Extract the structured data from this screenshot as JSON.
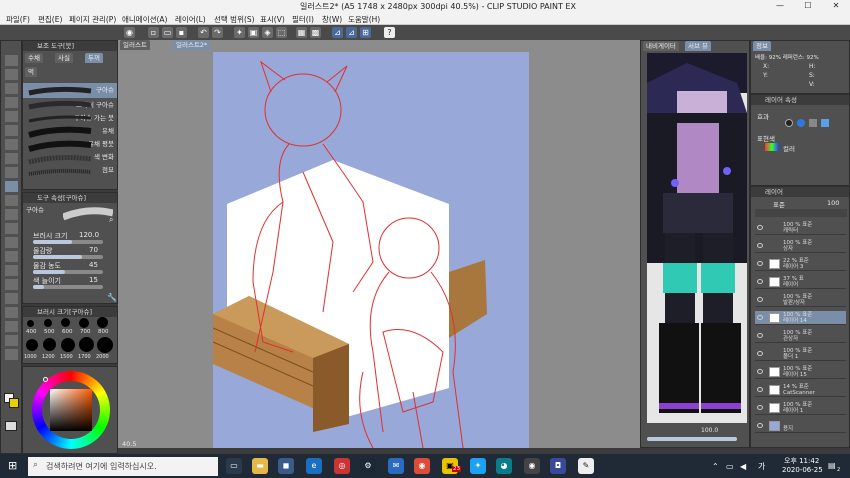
{
  "window": {
    "title": "일러스트2* (A5 1748 x 2480px 300dpi 40.5%) - CLIP STUDIO PAINT EX"
  },
  "menu": [
    "파일(F)",
    "편집(E)",
    "페이지 관리(P)",
    "애니메이션(A)",
    "레이어(L)",
    "선택 범위(S)",
    "표시(V)",
    "필터(I)",
    "창(W)",
    "도움말(H)"
  ],
  "tabs": {
    "doc1": "일러스트",
    "doc2": "일러스트2*"
  },
  "subtool": {
    "header": "보조 도구[붓]",
    "tabs": [
      "수채",
      "사실",
      "두꺼"
    ],
    "group_tab": "먹",
    "brushes": [
      "구아슈",
      "드라이 구아슈",
      "구아슈 가는 붓",
      "유채",
      "유채 평붓",
      "색 변화",
      "점묘"
    ]
  },
  "tool_property": {
    "header": "도구 속성[구아슈]",
    "brush_name": "구아슈",
    "rows": [
      {
        "label": "브러시 크기",
        "value": "120.0",
        "fill": 0.55
      },
      {
        "label": "물감량",
        "value": "70",
        "fill": 0.7
      },
      {
        "label": "물감 농도",
        "value": "45",
        "fill": 0.45
      },
      {
        "label": "색 늘이기",
        "value": "15",
        "fill": 0.15
      }
    ]
  },
  "brush_size": {
    "header": "브러시 크기[구아슈]",
    "row1": [
      "400",
      "500",
      "600",
      "700",
      "800"
    ],
    "row2": [
      "1000",
      "1200",
      "1500",
      "1700",
      "2000"
    ]
  },
  "zoom_readout": "40.5",
  "navigator": {
    "tab1": "내비게이터",
    "tab2": "서브 뷰",
    "tab3": "정보",
    "zoom_line": "배율: 92%  레퍼런스: 92%",
    "x_label": "X:",
    "y_label": "Y:",
    "h_label": "H:",
    "s_label": "S:",
    "v_label": "V:"
  },
  "layer_property": {
    "header": "레이어 속성",
    "effect_label": "효과",
    "display_label": "표현색",
    "display_value": "컬러"
  },
  "layers": {
    "header": "레이어",
    "blend": "표준",
    "opacity": "100",
    "items": [
      {
        "line1": "100 % 표준",
        "line2": "캐릭터"
      },
      {
        "line1": "100 % 표준",
        "line2": "상자"
      },
      {
        "line1": "22 % 표준",
        "line2": "레이어 3"
      },
      {
        "line1": "37 % 표",
        "line2": "레이어"
      },
      {
        "line1": "100 % 표준",
        "line2": "발판/상자"
      },
      {
        "line1": "100 % 표준",
        "line2": "레이어 14"
      },
      {
        "line1": "100 % 표준",
        "line2": "관상자"
      },
      {
        "line1": "100 % 표준",
        "line2": "폴더 1"
      },
      {
        "line1": "100 % 표준",
        "line2": "레이어 15"
      },
      {
        "line1": "14 % 표준",
        "line2": "CatScanner"
      },
      {
        "line1": "100 % 표준",
        "line2": "레이어 1"
      },
      {
        "line1": "",
        "line2": "용지"
      }
    ]
  },
  "subview_opacity": "100.0",
  "color_accent": "#7a8ea8",
  "taskbar": {
    "search_placeholder": "검색하려면 여기에 입력하십시오.",
    "time": "오후 11:42",
    "date": "2020-06-25",
    "ime": "가",
    "notification_count": "2",
    "badge_23": "23"
  }
}
